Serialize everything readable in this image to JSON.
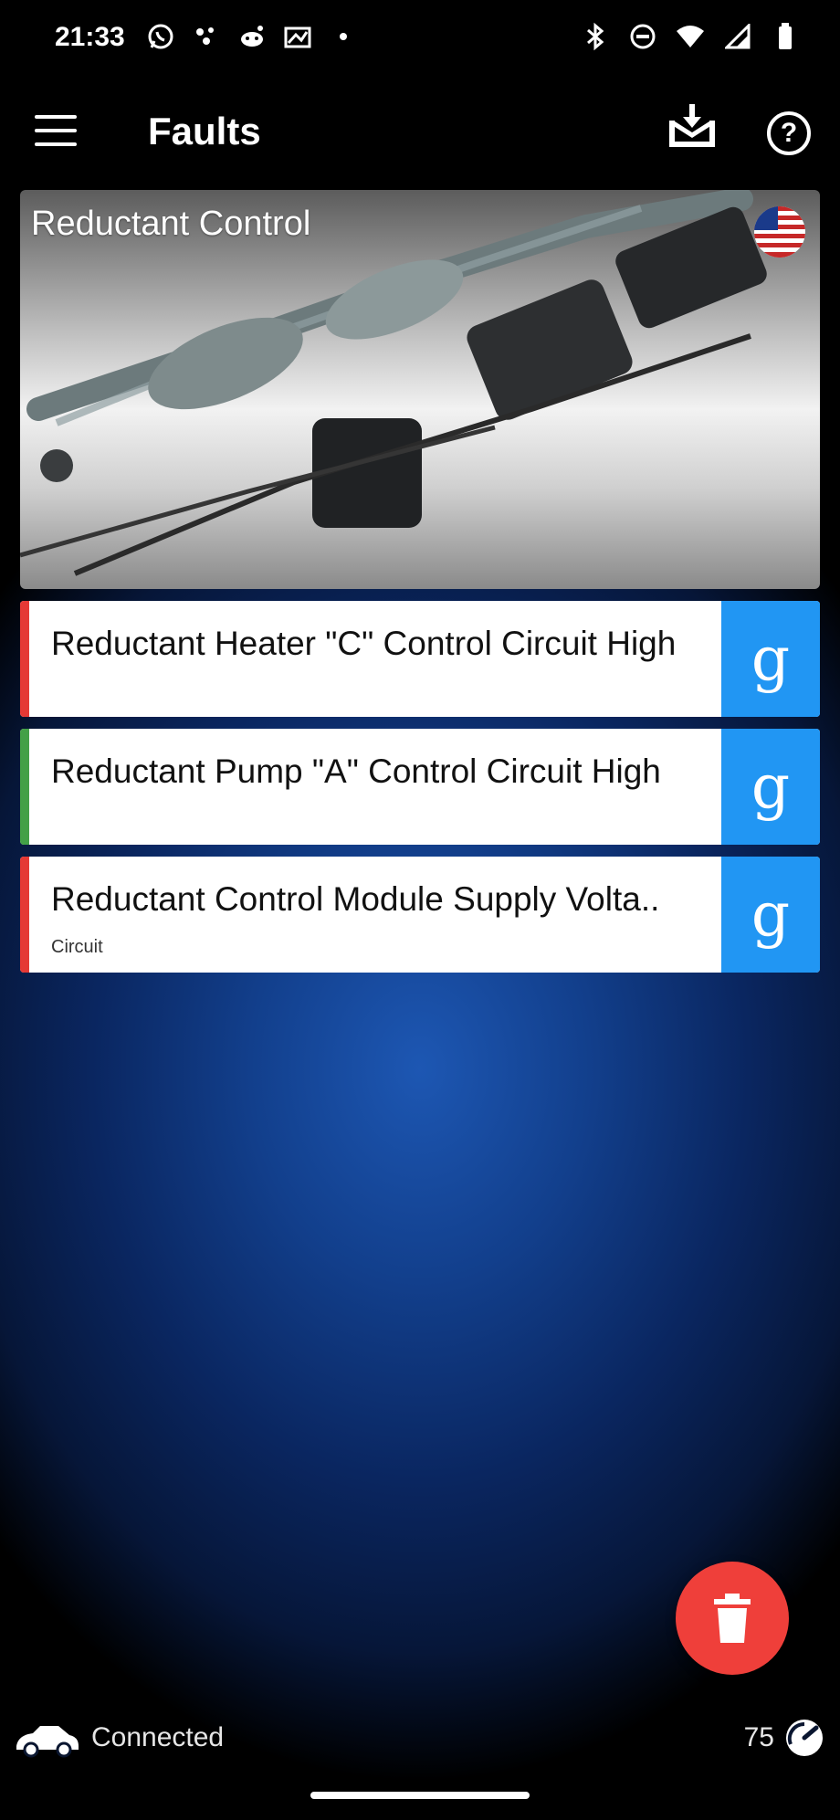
{
  "status_bar": {
    "time": "21:33",
    "left_icons": [
      "whatsapp-icon",
      "app-icon",
      "reddit-icon",
      "photo-icon",
      "dot-icon"
    ],
    "right_icons": [
      "bluetooth-icon",
      "dnd-icon",
      "wifi-icon",
      "signal-icon",
      "battery-icon"
    ]
  },
  "appbar": {
    "title": "Faults",
    "actions": [
      "download-icon",
      "help-icon"
    ]
  },
  "hero": {
    "title": "Reductant Control",
    "flag": "us-flag-icon"
  },
  "faults": [
    {
      "label": "Reductant Heater \"C\" Control Circuit High",
      "sub": "",
      "status_color": "#e53935",
      "action": "google-search"
    },
    {
      "label": "Reductant Pump \"A\" Control Circuit High",
      "sub": "",
      "status_color": "#43a047",
      "action": "google-search"
    },
    {
      "label": "Reductant Control Module Supply Volta..",
      "sub": "Circuit",
      "status_color": "#e53935",
      "action": "google-search"
    }
  ],
  "fab": {
    "icon": "trash-icon",
    "color": "#ef3f3a"
  },
  "bottom": {
    "connection": "Connected",
    "count": "75"
  },
  "colors": {
    "accent": "#2196f3"
  }
}
